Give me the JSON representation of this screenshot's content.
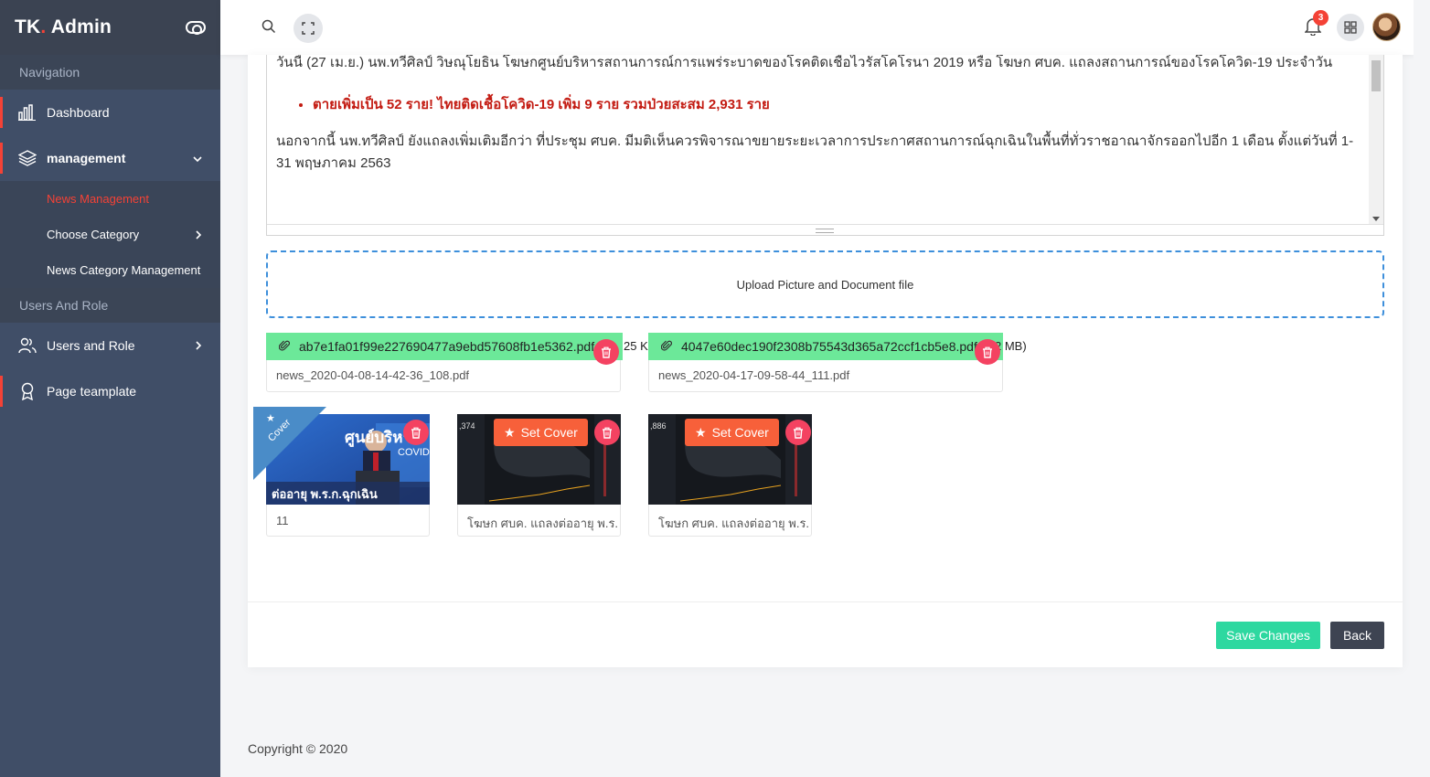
{
  "brand": {
    "text_main": "TK",
    "text_dot": ".",
    "text_rest": " Admin"
  },
  "sidebar": {
    "caption_navigation": "Navigation",
    "dashboard": "Dashboard",
    "management": "management",
    "sub_items": [
      "News Management",
      "Choose Category",
      "News Category Management"
    ],
    "caption_users": "Users And Role",
    "users_role": "Users and Role",
    "page_template": "Page teamplate"
  },
  "header": {
    "notification_count": "3"
  },
  "editor": {
    "para1": "วันนี้ (27 เม.ย.) นพ.ทวีศิลป์ วิษณุโยธิน โฆษกศูนย์บริหารสถานการณ์การแพร่ระบาดของโรคติดเชื้อไวรัสโคโรนา 2019 หรือ โฆษก ศบค. แถลงสถานการณ์ของโรคโควิด-19 ประจำวัน",
    "bullet": "ตายเพิ่มเป็น 52 ราย! ไทยติดเชื้อโควิด-19 เพิ่ม 9 ราย รวมป่วยสะสม 2,931 ราย",
    "para2": "นอกจากนี้ นพ.ทวีศิลป์ ยังแถลงเพิ่มเติมอีกว่า ที่ประชุม ศบค. มีมติเห็นควรพิจารณาขยายระยะเวลาการประกาศสถานการณ์ฉุกเฉินในพื้นที่ทั่วราชอาณาจักรออกไปอีก 1 เดือน ตั้งแต่วันที่ 1-31 พฤษภาคม 2563"
  },
  "dropzone": {
    "label": "Upload Picture and Document file"
  },
  "files": [
    {
      "hash": "ab7e1fa01f99e227690477a9ebd57608fb1e5362.pdf",
      "size_fragment": "25 KI",
      "name": "news_2020-04-08-14-42-36_108.pdf"
    },
    {
      "hash": "4047e60dec190f2308b75543d365a72ccf1cb5e8.pdf",
      "size_fragment": "2 MB)",
      "name": "news_2020-04-17-09-58-44_111.pdf"
    }
  ],
  "images": [
    {
      "caption": "11",
      "cover_label": "Cover",
      "thumb_text": "ต่ออายุ พ.ร.ก.ฉุกเฉิน",
      "thumb_side": "ศูนย์บริหา",
      "thumb_covid": "COVID"
    },
    {
      "caption": "โฆษก ศบค. แถลงต่ออายุ พ.ร.",
      "set_cover": "Set Cover",
      "thumb_num": ",374"
    },
    {
      "caption": "โฆษก ศบค. แถลงต่ออายุ พ.ร.",
      "set_cover": "Set Cover",
      "thumb_num": ",886"
    }
  ],
  "actions": {
    "save": "Save Changes",
    "back": "Back"
  },
  "footer": {
    "copyright": "Copyright © 2020"
  },
  "colors": {
    "accent_red": "#f44236",
    "sidebar_bg": "#404e67",
    "green": "#2ed8a0",
    "file_bar": "#6ce899",
    "delete": "#f44261",
    "set_cover": "#f7603a",
    "dropzone_border": "#3d8fdb"
  }
}
